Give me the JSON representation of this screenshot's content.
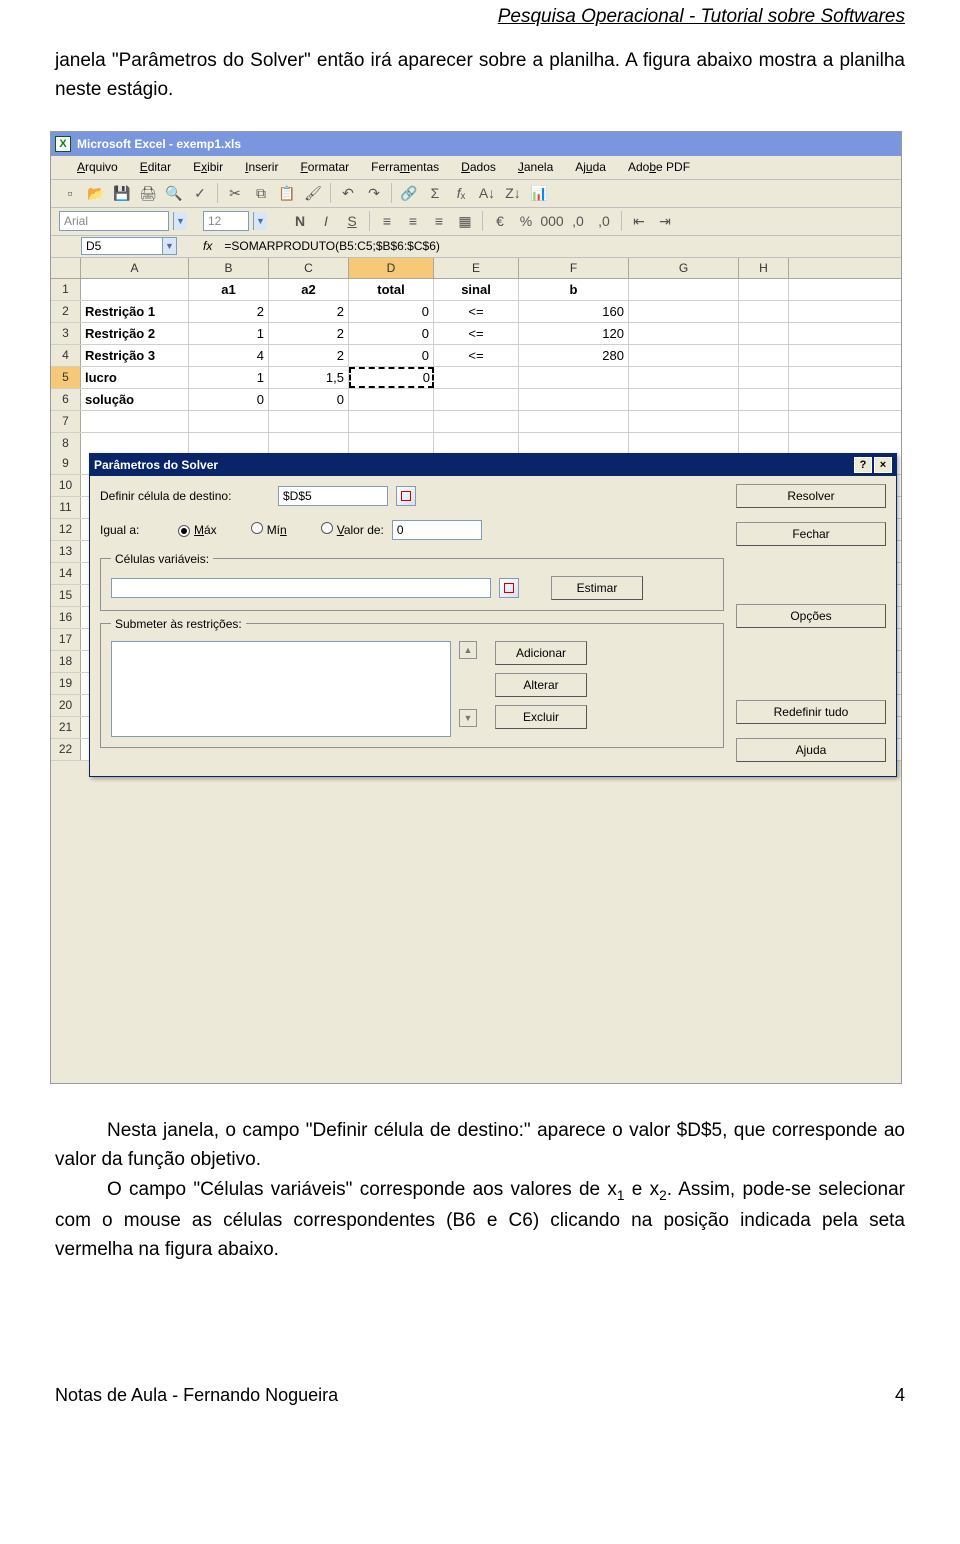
{
  "doc": {
    "header": "Pesquisa Operacional - Tutorial sobre Softwares",
    "p1": "janela \"Parâmetros do Solver\" então irá aparecer sobre a planilha. A figura abaixo mostra a planilha neste estágio.",
    "p2": "Nesta janela, o campo \"Definir célula de destino:\" aparece o valor $D$5, que corresponde ao valor da função objetivo.",
    "p3a": "O campo \"Células variáveis\" corresponde aos valores de x",
    "p3b": " e x",
    "p3c": ". Assim, pode-se selecionar com o mouse as células correspondentes (B6 e C6) clicando na posição indicada pela seta vermelha na figura abaixo.",
    "footer_left": "Notas de Aula - Fernando Nogueira",
    "footer_right": "4"
  },
  "excel": {
    "title": "Microsoft Excel - exemp1.xls",
    "menus": [
      "Arquivo",
      "Editar",
      "Exibir",
      "Inserir",
      "Formatar",
      "Ferramentas",
      "Dados",
      "Janela",
      "Ajuda",
      "Adobe PDF"
    ],
    "menu_underline": [
      "A",
      "E",
      "x",
      "I",
      "F",
      "m",
      "D",
      "J",
      "u",
      ""
    ],
    "font_name": "Arial",
    "font_size": "12",
    "name_box": "D5",
    "fx": "fx",
    "formula": "=SOMARPRODUTO(B5:C5;$B$6:$C$6)",
    "col_labels": [
      "A",
      "B",
      "C",
      "D",
      "E",
      "F",
      "G",
      "H"
    ],
    "rows": [
      {
        "n": "1",
        "cells": [
          "",
          "a1",
          "a2",
          "total",
          "sinal",
          "b",
          "",
          ""
        ],
        "bold": true
      },
      {
        "n": "2",
        "cells": [
          "Restrição 1",
          "2",
          "2",
          "0",
          "<=",
          "160",
          "",
          ""
        ]
      },
      {
        "n": "3",
        "cells": [
          "Restrição 2",
          "1",
          "2",
          "0",
          "<=",
          "120",
          "",
          ""
        ]
      },
      {
        "n": "4",
        "cells": [
          "Restrição 3",
          "4",
          "2",
          "0",
          "<=",
          "280",
          "",
          ""
        ]
      },
      {
        "n": "5",
        "cells": [
          "lucro",
          "1",
          "1,5",
          "0",
          "",
          "",
          "",
          ""
        ],
        "selD": true
      },
      {
        "n": "6",
        "cells": [
          "solução",
          "0",
          "0",
          "",
          "",
          "",
          "",
          ""
        ]
      },
      {
        "n": "7",
        "cells": [
          "",
          "",
          "",
          "",
          "",
          "",
          "",
          ""
        ]
      },
      {
        "n": "8",
        "cells": [
          "",
          "",
          "",
          "",
          "",
          "",
          "",
          ""
        ]
      }
    ],
    "tail_rows": [
      "9",
      "10",
      "11",
      "12",
      "13",
      "14",
      "15",
      "16",
      "17",
      "18",
      "19",
      "20",
      "21",
      "22"
    ]
  },
  "solver": {
    "title": "Parâmetros do Solver",
    "lbl_target": "Definir célula de destino:",
    "target_value": "$D$5",
    "lbl_equal": "Igual a:",
    "opt_max": "Máx",
    "opt_min": "Mín",
    "opt_value": "Valor de:",
    "value_of": "0",
    "grp_vars": "Células variáveis:",
    "grp_constraints": "Submeter às restrições:",
    "btn_resolve": "Resolver",
    "btn_close": "Fechar",
    "btn_estimate": "Estimar",
    "btn_options": "Opções",
    "btn_add": "Adicionar",
    "btn_change": "Alterar",
    "btn_delete": "Excluir",
    "btn_reset": "Redefinir tudo",
    "btn_help": "Ajuda"
  }
}
